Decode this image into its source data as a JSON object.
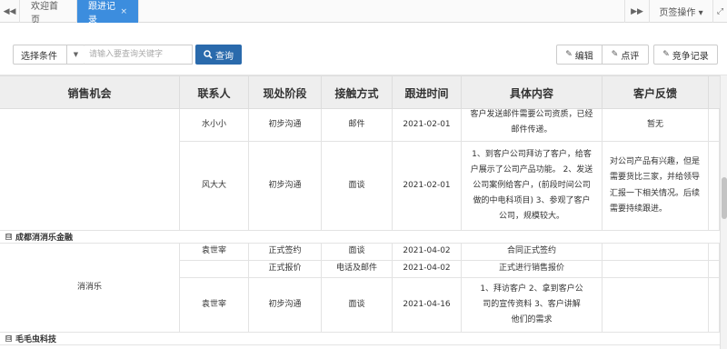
{
  "tabs": {
    "prev": "◀◀",
    "next": "▶▶",
    "expand": "⤢",
    "items": [
      {
        "label": "欢迎首页"
      },
      {
        "label": "跟进记录",
        "close": "×"
      }
    ],
    "tab_ops": "页签操作 ▾"
  },
  "toolbar": {
    "select_condition": "选择条件",
    "search_placeholder": "请输入要查询关键字",
    "query_label": "查询",
    "edit_label": "编辑",
    "comment_label": "点评",
    "competitor_label": "竞争记录"
  },
  "table": {
    "headers": [
      "销售机会",
      "联系人",
      "现处阶段",
      "接触方式",
      "跟进时间",
      "具体内容",
      "客户反馈"
    ],
    "group1_rows": [
      {
        "contact": "水小小",
        "stage": "初步沟通",
        "method": "邮件",
        "time": "2021-02-01",
        "content": "客户发送邮件需要公司资质，已经邮件传递。",
        "feedback": "暂无"
      },
      {
        "contact": "风大大",
        "stage": "初步沟通",
        "method": "面谈",
        "time": "2021-02-01",
        "content": "1、到客户公司拜访了客户，给客户展示了公司产品功能。 2、发送公司案例给客户，(前段时间公司做的中电科项目) 3、参观了客户公司，规模较大。",
        "feedback": "对公司产品有兴趣，但是需要货比三家，并给领导汇报一下相关情况。后续需要持续跟进。"
      }
    ],
    "group2": {
      "title": "成都消消乐金融",
      "opportunity": "消消乐",
      "rows": [
        {
          "contact": "袁世宰",
          "stage": "正式签约",
          "method": "面谈",
          "time": "2021-04-02",
          "content": "合同正式签约",
          "feedback": ""
        },
        {
          "contact": "",
          "stage": "正式报价",
          "method": "电话及邮件",
          "time": "2021-04-02",
          "content": "正式进行销售报价",
          "feedback": ""
        },
        {
          "contact": "袁世宰",
          "stage": "初步沟通",
          "method": "面谈",
          "time": "2021-04-16",
          "content": "1、拜访客户 2、拿到客户公司的宣传资料 3、客户讲解他们的需求",
          "feedback": ""
        }
      ]
    },
    "group3": {
      "title": "毛毛虫科技"
    },
    "group_toggle": "⊟"
  }
}
